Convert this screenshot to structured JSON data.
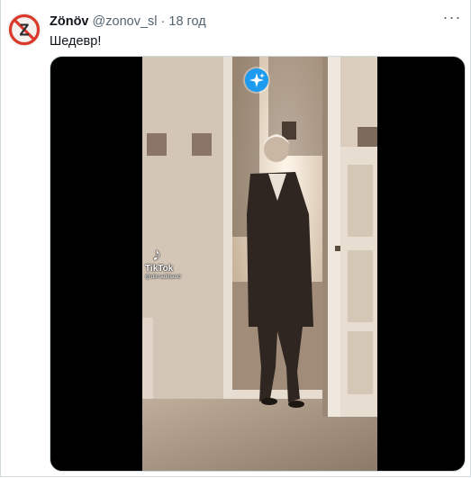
{
  "tweet": {
    "author_name": "Zönöv",
    "author_handle": "@zonov_sl",
    "separator": "·",
    "time": "18 год",
    "text": "Шедевр!",
    "avatar_letter": "Z"
  },
  "media": {
    "watermark_brand": "TikTok",
    "watermark_handle": "@dimaditiand"
  },
  "icons": {
    "more": "more-options-icon",
    "grok": "grok-sparkle-icon",
    "tiktok": "tiktok-logo-icon"
  },
  "colors": {
    "accent": "#1d9bf0",
    "avatar_ring": "#d9382b",
    "text_primary": "#0f1419",
    "text_secondary": "#536471"
  }
}
